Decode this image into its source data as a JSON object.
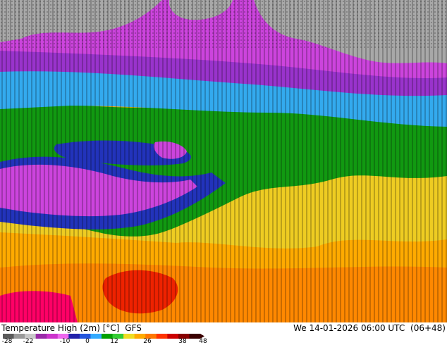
{
  "header": {
    "parameter": "Temperature High (2m) [°C]",
    "model": "GFS",
    "valid_time": "We 14-01-2026 06:00 UTC",
    "lead": "(06+48)"
  },
  "legend": {
    "ticks": [
      "-28",
      "-22",
      "-10",
      "0",
      "12",
      "26",
      "38",
      "48"
    ],
    "colors": [
      "#5a5a5a",
      "#9a9a9a",
      "#c8c8c8",
      "#9a2aa8",
      "#cc33cc",
      "#ee66ee",
      "#2222aa",
      "#2255dd",
      "#33aaff",
      "#00a000",
      "#33cc33",
      "#eedd22",
      "#ffaa00",
      "#ff7700",
      "#ff3300",
      "#cc0000",
      "#880000",
      "#3a0000"
    ]
  },
  "map": {
    "field_colors": {
      "gray": "#a8a8a8",
      "purple": "#cc44dd",
      "violet": "#9933cc",
      "blue": "#2233bb",
      "light_blue": "#33aaee",
      "green": "#119911",
      "yellow": "#eecc22",
      "orange": "#ffaa00",
      "dark_orange": "#ff8800",
      "red": "#ee2200",
      "deep_red": "#ff0066"
    }
  }
}
